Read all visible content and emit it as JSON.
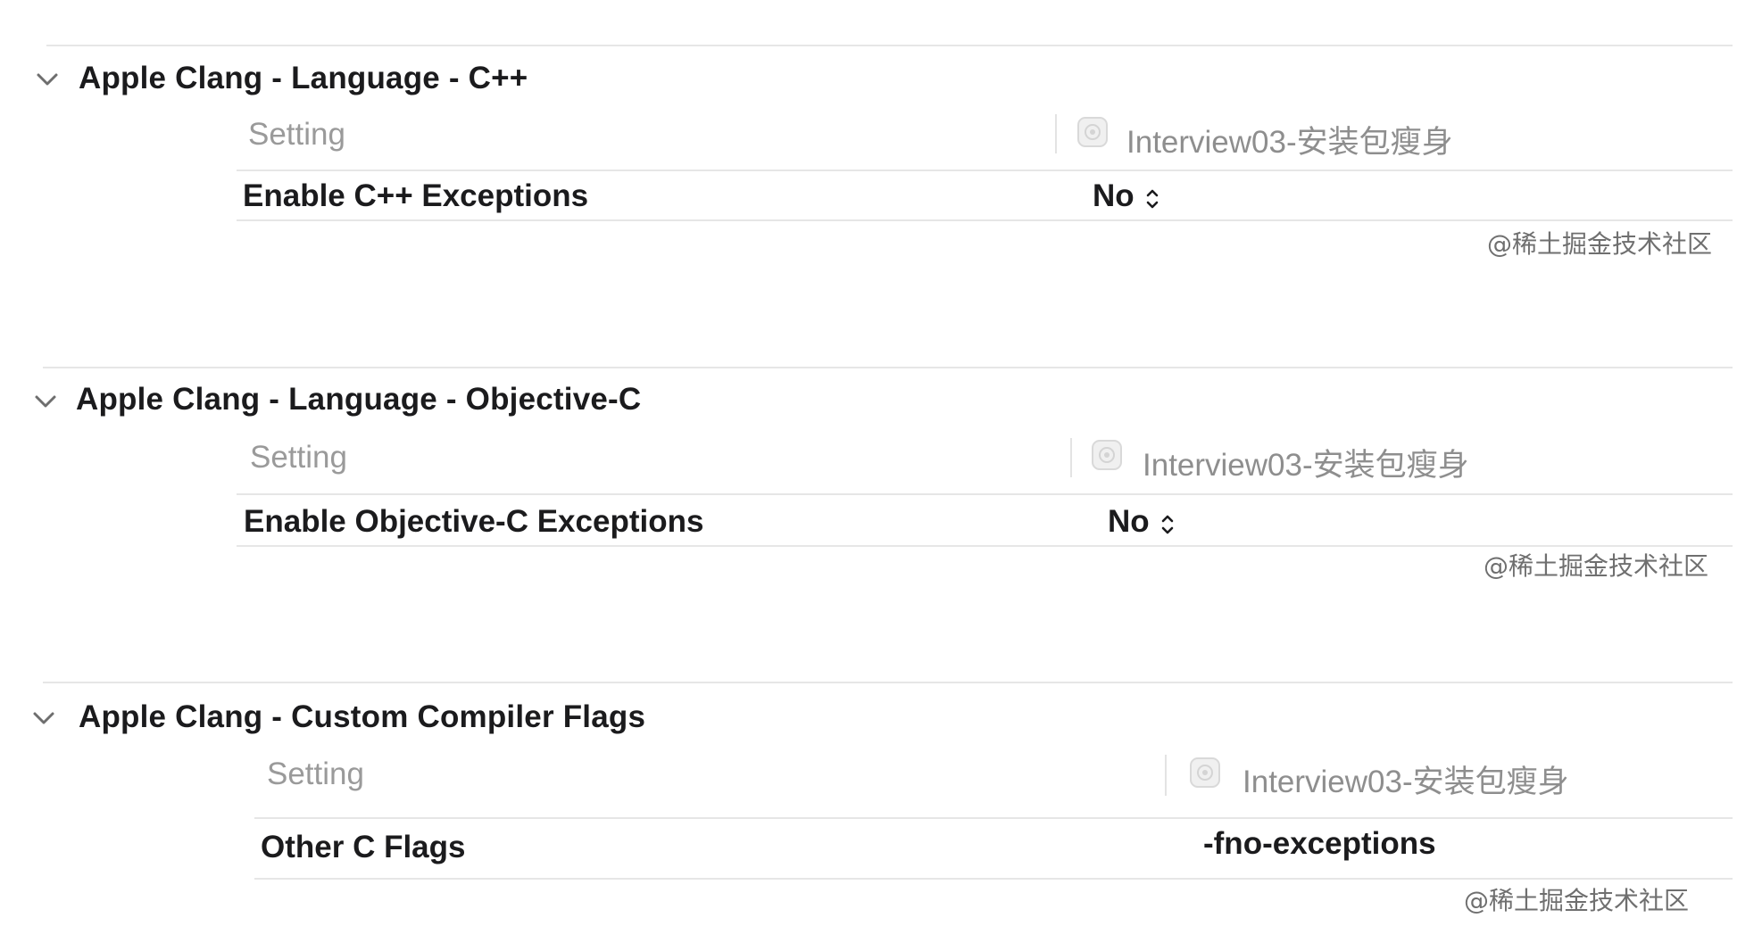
{
  "sections": [
    {
      "title": "Apple Clang - Language - C++",
      "column_header": "Setting",
      "target_name": "Interview03-安装包瘦身",
      "row_label": "Enable C++ Exceptions",
      "row_value": "No",
      "watermark": "@稀土掘金技术社区"
    },
    {
      "title": "Apple Clang - Language - Objective-C",
      "column_header": "Setting",
      "target_name": "Interview03-安装包瘦身",
      "row_label": "Enable Objective-C Exceptions",
      "row_value": "No",
      "watermark": "@稀土掘金技术社区"
    },
    {
      "title": "Apple Clang - Custom Compiler Flags",
      "column_header": "Setting",
      "target_name": "Interview03-安装包瘦身",
      "row_label": "Other C Flags",
      "row_value": "-fno-exceptions",
      "watermark": "@稀土掘金技术社区"
    }
  ],
  "icons": {
    "disclosure": "chevron-down-icon",
    "target": "app-target-icon",
    "stepper": "updown-stepper-icon"
  },
  "colors": {
    "text": "#1b1b1d",
    "secondary_text": "#9a9a9a",
    "rule": "#e6e6e6"
  }
}
